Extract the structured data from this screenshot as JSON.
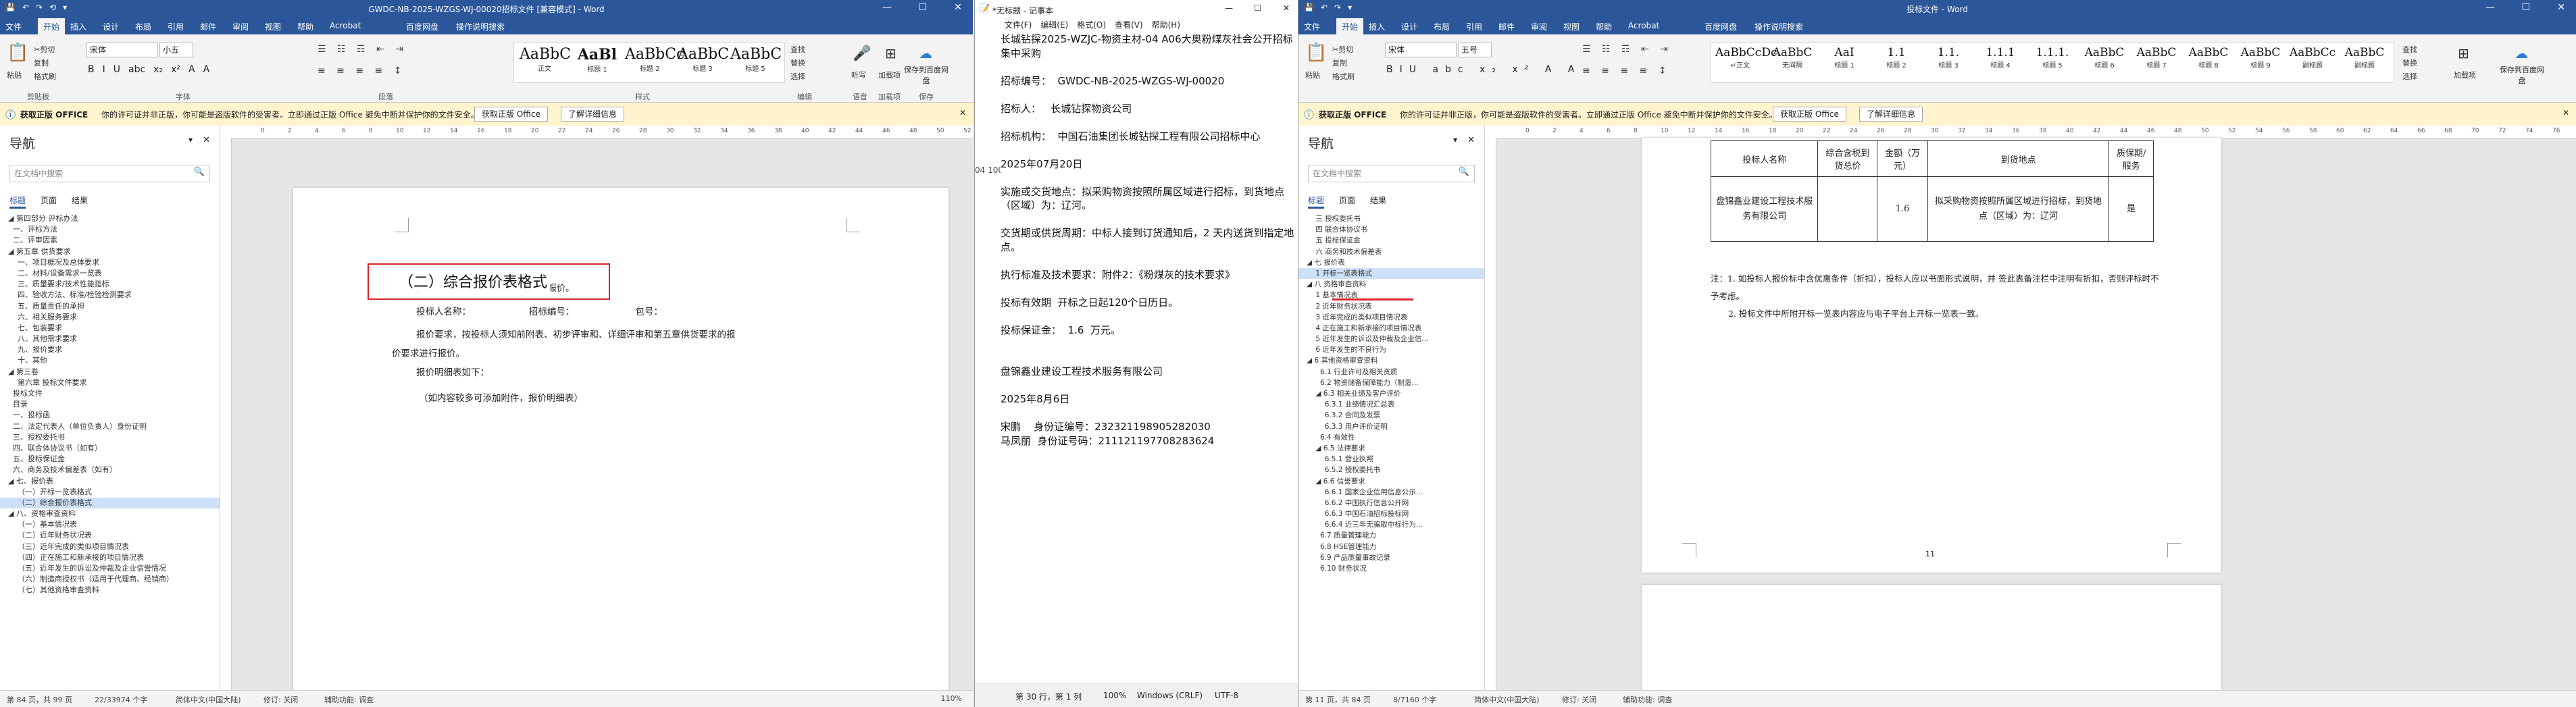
{
  "left_word": {
    "title": "GWDC-NB-2025-WZGS-WJ-00020招标文件 [兼容模式] - Word",
    "quick_access": [
      "💾",
      "↶",
      "↷",
      "⟲",
      "▾"
    ],
    "tabs": [
      "文件",
      "开始",
      "插入",
      "设计",
      "布局",
      "引用",
      "邮件",
      "审阅",
      "视图",
      "帮助",
      "Acrobat",
      "百度网盘",
      "操作说明搜索"
    ],
    "clipboard": {
      "paste": "粘贴",
      "cut": "✂剪切",
      "copy": "复制",
      "format_painter": "格式刷",
      "group": "剪贴板"
    },
    "font": {
      "name": "宋体",
      "size": "小五",
      "group": "字体",
      "buttons": [
        "B",
        "I",
        "U",
        "abc",
        "x₂",
        "x²",
        "A",
        "A"
      ]
    },
    "paragraph": {
      "group": "段落"
    },
    "styles": {
      "group": "样式",
      "items": [
        {
          "preview": "AaBbC",
          "name": "正文"
        },
        {
          "preview": "AaBl",
          "name": "标题 1"
        },
        {
          "preview": "AaBbCc",
          "name": "标题 2"
        },
        {
          "preview": "AaBbC",
          "name": "标题 3"
        },
        {
          "preview": "AaBbC",
          "name": "标题 5"
        }
      ]
    },
    "editing": {
      "find": "查找",
      "replace": "替换",
      "select": "选择",
      "group": "编辑"
    },
    "dictate": {
      "label": "听写",
      "group": "语音"
    },
    "sign": {
      "label": "加载项",
      "group": "加载项"
    },
    "save_baidu": {
      "label": "保存到百度网盘",
      "group": "保存"
    },
    "infobar": {
      "badge": "获取正版 OFFICE",
      "text": "你的许可证并非正版，你可能是盗版软件的受害者。立即通过正版 Office 避免中断并保护你的文件安全。",
      "btn1": "获取正版 Office",
      "btn2": "了解详细信息"
    },
    "nav": {
      "title": "导航",
      "search_placeholder": "在文档中搜索",
      "tabs": [
        "标题",
        "页面",
        "结果"
      ],
      "items": [
        "◢ 第四部分 评标办法",
        "  一、评标方法",
        "  二、评审因素",
        "◢ 第五章 供货要求",
        "    一、项目概况及总体要求",
        "    二、材料/设备需求一览表",
        "    三、质量要求/技术性能指标",
        "    四、验收方法、标准/检验检测要求",
        "    五、质量责任的承担",
        "    六、相关服务要求",
        "    七、包装要求",
        "    八、其他需求要求",
        "    九、报价要求",
        "    十、其他",
        "◢ 第三卷",
        "    第六章 投标文件要求",
        "  投标文件",
        "  目录",
        "  一、投标函",
        "  二、法定代表人（单位负责人）身份证明",
        "  三、授权委托书",
        "  四、联合体协议书（如有）",
        "  五、投标保证金",
        "  六、商务及技术偏差表（如有）",
        "◢ 七、报价表",
        "    （一）开标一览表格式",
        "    （二）综合报价表格式",
        "◢ 八、资格审查资料",
        "    （一）基本情况表",
        "    （二）近年财务状况表",
        "    （三）近年完成的类似项目情况表",
        "    （四）正在施工和新承接的项目情况表",
        "    （五）近年发生的诉讼及仲裁及企业信誉情况",
        "    （六）制造商授权书（适用于代理商、经销商）",
        "    （七）其他资格审查资料"
      ],
      "selected_index": 26
    },
    "doc": {
      "heading": "（二）综合报价表格式",
      "lines": [
        "投标人名称：                    招标编号：                     包号：",
        "报价要求，按投标人须知前附表、初步评审和、详细评审和第五章供货要求的报",
        "价要求进行报价。",
        "报价明细表如下："
      ],
      "top_line": "按第五章供货要求的报价要求进行报价。",
      "note": "（如内容较多可添加附件，报价明细表）"
    },
    "status": {
      "page": "第 84 页，共 99 页",
      "words": "22/33974 个字",
      "lang": "简体中文(中国大陆)",
      "track": "修订: 关闭",
      "access": "辅助功能: 调查",
      "zoom": "110%"
    }
  },
  "notepad": {
    "title": "*无标题 - 记事本",
    "menu": [
      "文件(F)",
      "编辑(E)",
      "格式(O)",
      "查看(V)",
      "帮助(H)"
    ],
    "lines": [
      "长城钻探2025-WZJC-物资主材-04 A06大奥粉煤灰社会公开招标集中采购",
      "",
      "招标编号：  GWDC-NB-2025-WZGS-WJ-00020",
      "",
      "招标人：   长城钻探物资公司",
      "",
      "招标机构：  中国石油集团长城钻探工程有限公司招标中心",
      "",
      "2025年07月20日",
      "",
      "实施或交货地点：拟采购物资按照所属区域进行招标，到货地点（区域）为：辽河。",
      "",
      "交货期或供货周期：中标人接到订货通知后，2 天内送货到指定地点。",
      "",
      "执行标准及技术要求：附件2：《粉煤灰的技术要求》",
      "",
      "投标有效期  开标之日起120个日历日。",
      "",
      "投标保证金：  1.6  万元。",
      "",
      "",
      "盘锦鑫业建设工程技术服务有限公司",
      "",
      "2025年8月6日",
      "",
      "宋鹏    身份证编号：232321198905282030",
      "马凤丽  身份证号码：211121197708283624"
    ],
    "side_text": "04 100t",
    "status": {
      "pos": "第 30 行，第 1 列",
      "zoom": "100%",
      "eol": "Windows (CRLF)",
      "enc": "UTF-8"
    }
  },
  "right_word": {
    "title": "投标文件 - Word",
    "tabs": [
      "文件",
      "开始",
      "插入",
      "设计",
      "布局",
      "引用",
      "邮件",
      "审阅",
      "视图",
      "帮助",
      "Acrobat",
      "百度网盘",
      "操作说明搜索"
    ],
    "font": {
      "name": "宋体",
      "size": "五号"
    },
    "styles": [
      "AaBbCcDc",
      "AaBbC",
      "AaI",
      "1.1",
      "1.1.",
      "1.1.1",
      "1.1.1.",
      "AaBbC",
      "AaBbC",
      "AaBbC",
      "AaBbC",
      "AaBbCc",
      "AaBbC"
    ],
    "style_names": [
      "↵正文",
      "无间隔",
      "标题 1",
      "标题 2",
      "标题 3",
      "标题 4",
      "标题 5",
      "标题 6",
      "标题 7",
      "标题 8",
      "标题 9",
      "副标题",
      "副标题"
    ],
    "infobar": {
      "badge": "获取正版 OFFICE",
      "text": "你的许可证并非正版，你可能是盗版软件的受害者。立即通过正版 Office 避免中断并保护你的文件安全。",
      "btn1": "获取正版 Office",
      "btn2": "了解详细信息"
    },
    "nav": {
      "title": "导航",
      "search_placeholder": "在文档中搜索",
      "tabs": [
        "标题",
        "页面",
        "结果"
      ],
      "items": [
        "    三 授权委托书",
        "    四 联合体协议书",
        "    五 投标保证金",
        "    六 商务和技术偏差表",
        "◢ 七 报价表",
        "    1 开标一览表格式",
        "◢ 八 资格审查资料",
        "    1 基本情况表",
        "    2 近年财务状况表",
        "    3 近年完成的类似项目情况表",
        "    4 正在施工和新承接的项目情况表",
        "    5 近年发生的诉讼及仲裁及企业信...",
        "    6 近年发生的不良行为",
        "◢ 6 其他资格审查资料",
        "      6.1 行业许可及相关资质",
        "      6.2 物资储备保障能力（制造...",
        "    ◢ 6.3 相关业绩及客户评价",
        "        6.3.1 业绩情况汇总表",
        "        6.3.2 合同及发票",
        "        6.3.3 用户评价证明",
        "      6.4 有效性",
        "    ◢ 6.5 法律要求",
        "        6.5.1 营业执照",
        "        6.5.2 授权委托书",
        "    ◢ 6.6 信誉要求",
        "        6.6.1 国家企业信用信息公示...",
        "        6.6.2 中国执行信息公开网",
        "        6.6.3 中国石油招标投标网",
        "        6.6.4 近三年无骗取中标行为...",
        "      6.7 质量管理能力",
        "      6.8 HSE管理能力",
        "      6.9 产品质量事故记录",
        "      6.10 财务状况"
      ],
      "selected_index": 5
    },
    "table": {
      "headers": [
        "投标人名称",
        "综合含税到货总价",
        "金额（万元）",
        "到货地点",
        "质保期/服务"
      ],
      "row": [
        "盘锦鑫业建设工程技术服务有限公司",
        "",
        "1.6",
        "拟采购物资按照所属区域进行招标，到货地点（区域）为：辽河",
        "是"
      ]
    },
    "notes": [
      "注：1. 如投标人报价标中含优惠条件（折扣），投标人应以书面形式说明，并 签此表备注栏中注明有折扣，否则评标时不予考虑。",
      "2. 投标文件中所附开标一览表内容应与电子平台上开标一览表一致。"
    ],
    "page_no": "11",
    "status": {
      "page": "第 11 页，共 84 页",
      "words": "8/7160 个字",
      "lang": "简体中文(中国大陆)",
      "track": "修订: 关闭",
      "access": "辅助功能: 调查"
    }
  },
  "colors": {
    "word_blue": "#2b579a",
    "highlight_red": "#d9232a",
    "info_yellow": "#fff4ce"
  }
}
